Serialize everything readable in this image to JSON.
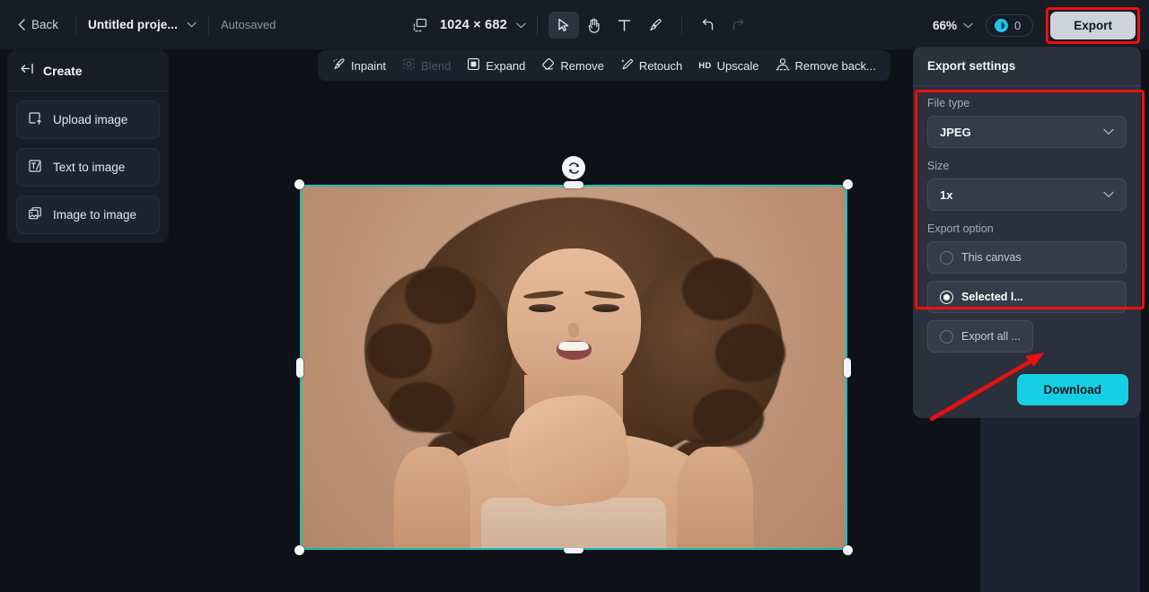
{
  "topbar": {
    "back_label": "Back",
    "project_name": "Untitled proje...",
    "autosave_label": "Autosaved",
    "canvas_size": "1024 × 682",
    "tools": [
      {
        "name": "select-tool",
        "icon": "cursor-icon",
        "active": true
      },
      {
        "name": "pan-tool",
        "icon": "hand-icon",
        "active": false
      },
      {
        "name": "text-tool",
        "icon": "text-icon",
        "active": false
      },
      {
        "name": "brush-tool",
        "icon": "brush-icon",
        "active": false
      },
      {
        "name": "undo-tool",
        "icon": "undo-icon",
        "active": false
      },
      {
        "name": "redo-tool",
        "icon": "redo-icon",
        "active": false
      }
    ],
    "zoom_level": "66%",
    "credits_count": "0",
    "export_label": "Export"
  },
  "sidebar": {
    "title": "Create",
    "collapse_icon": "collapse-left-icon",
    "items": [
      {
        "label": "Upload image",
        "icon": "upload-image-icon"
      },
      {
        "label": "Text to image",
        "icon": "text-to-image-icon"
      },
      {
        "label": "Image to image",
        "icon": "image-to-image-icon"
      }
    ]
  },
  "canvas_toolbar": {
    "items": [
      {
        "label": "Inpaint",
        "icon": "inpaint-icon",
        "disabled": false
      },
      {
        "label": "Blend",
        "icon": "blend-icon",
        "disabled": true
      },
      {
        "label": "Expand",
        "icon": "expand-icon",
        "disabled": false
      },
      {
        "label": "Remove",
        "icon": "remove-icon",
        "disabled": false
      },
      {
        "label": "Retouch",
        "icon": "retouch-icon",
        "disabled": false
      },
      {
        "label": "Upscale",
        "icon": "hd-upscale-icon",
        "disabled": false,
        "tag": "HD"
      },
      {
        "label": "Remove back...",
        "icon": "remove-background-icon",
        "disabled": false
      }
    ]
  },
  "canvas": {
    "selection_color": "#12c4bd",
    "rotate_icon": "rotate-icon",
    "image_description": "Portrait of a smiling woman with long curly brown hair on a beige background"
  },
  "export_panel": {
    "title": "Export settings",
    "file_type": {
      "label": "File type",
      "value": "JPEG"
    },
    "size": {
      "label": "Size",
      "value": "1x"
    },
    "export_option": {
      "label": "Export option",
      "options": [
        {
          "label": "This canvas",
          "selected": false
        },
        {
          "label": "Selected l...",
          "selected": true
        },
        {
          "label": "Export all ...",
          "selected": false
        }
      ]
    },
    "download_label": "Download"
  },
  "annotations": {
    "highlight_color": "#f30c0c",
    "arrow_color": "#e81010"
  }
}
